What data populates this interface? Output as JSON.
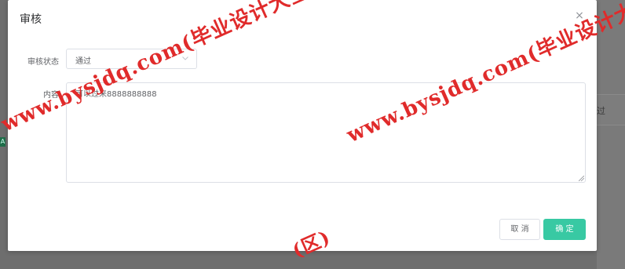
{
  "background": {
    "row_text": "过",
    "badge_text": "A"
  },
  "dialog": {
    "title": "审核",
    "close_label": "×",
    "form": {
      "status_label": "审核状态",
      "status_value": "通过",
      "content_label": "内容",
      "content_value": "可以过来8888888888"
    },
    "footer": {
      "cancel_label": "取 消",
      "confirm_label": "确 定"
    }
  },
  "watermark": {
    "text": "www.bysjdq.com(毕业设计大全)",
    "text_right": "www.bysjdq.com(毕业设计大",
    "text_bottom": "(区)"
  },
  "colors": {
    "primary": "#38c9a3",
    "watermark": "#e02b2b"
  }
}
